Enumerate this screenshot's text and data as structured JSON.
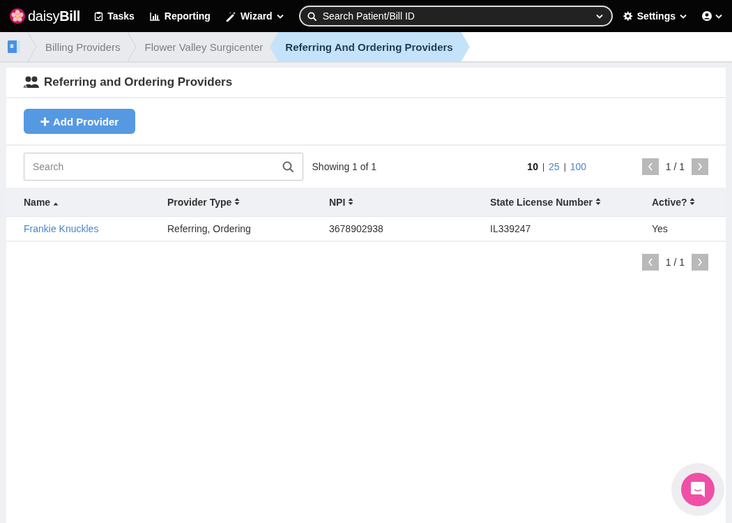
{
  "topnav": {
    "brand": {
      "light": "daisy",
      "bold": "Bill"
    },
    "items": [
      {
        "label": "Tasks",
        "dropdown": false
      },
      {
        "label": "Reporting",
        "dropdown": false
      },
      {
        "label": "Wizard",
        "dropdown": true
      }
    ],
    "search": {
      "placeholder": "Search Patient/Bill ID"
    },
    "settings": {
      "label": "Settings",
      "dropdown": true
    },
    "user_menu": {
      "dropdown": true
    }
  },
  "breadcrumbs": [
    {
      "label": "Billing Providers",
      "selected": false
    },
    {
      "label": "Flower Valley Surgicenter",
      "selected": false
    },
    {
      "label": "Referring And Ordering Providers",
      "selected": true
    }
  ],
  "panel": {
    "title": "Referring and Ordering Providers",
    "add_button": "Add Provider",
    "search": {
      "placeholder": "Search"
    },
    "showing": "Showing 1 of 1",
    "page_sizes": [
      {
        "label": "10",
        "selected": true
      },
      {
        "label": "25",
        "selected": false
      },
      {
        "label": "100",
        "selected": false
      }
    ],
    "separator": "|",
    "page_top": "1 / 1",
    "page_bottom": "1 / 1",
    "table": {
      "columns": [
        {
          "label": "Name",
          "sorted": true
        },
        {
          "label": "Provider Type",
          "sorted": false
        },
        {
          "label": "NPI",
          "sorted": false
        },
        {
          "label": "State License Number",
          "sorted": false
        },
        {
          "label": "Active?",
          "sorted": false
        }
      ],
      "rows": [
        {
          "cells": [
            "Frankie Knuckles",
            "Referring, Ordering",
            "3678902938",
            "IL339247",
            "Yes"
          ]
        }
      ]
    }
  }
}
